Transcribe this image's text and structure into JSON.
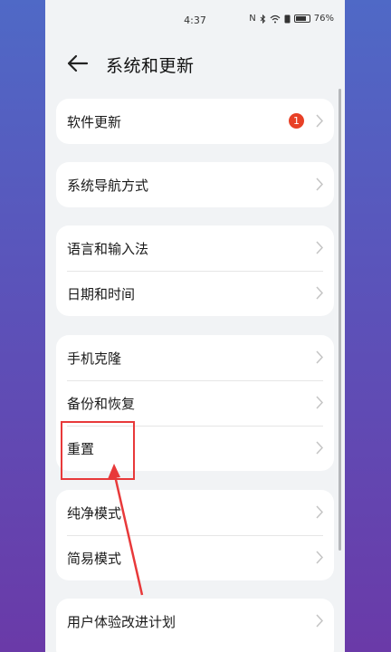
{
  "status_bar": {
    "time": "4:37",
    "icons": [
      "nfc-icon",
      "bluetooth-icon",
      "wifi-icon",
      "sim-icon",
      "battery-icon"
    ],
    "battery": "76%"
  },
  "header": {
    "back_icon": "arrow-left-icon",
    "title": "系统和更新"
  },
  "groups": [
    {
      "items": [
        {
          "label": "软件更新",
          "badge": "1"
        }
      ]
    },
    {
      "items": [
        {
          "label": "系统导航方式"
        }
      ]
    },
    {
      "items": [
        {
          "label": "语言和输入法"
        },
        {
          "label": "日期和时间"
        }
      ]
    },
    {
      "items": [
        {
          "label": "手机克隆"
        },
        {
          "label": "备份和恢复"
        },
        {
          "label": "重置"
        }
      ]
    },
    {
      "items": [
        {
          "label": "纯净模式"
        },
        {
          "label": "简易模式"
        }
      ]
    },
    {
      "items": [
        {
          "label": "用户体验改进计划"
        }
      ]
    }
  ],
  "colors": {
    "badge": "#e84026",
    "annotation": "#e8393a",
    "background_top": "#4f69c6",
    "background_bottom": "#6a3aa8"
  }
}
